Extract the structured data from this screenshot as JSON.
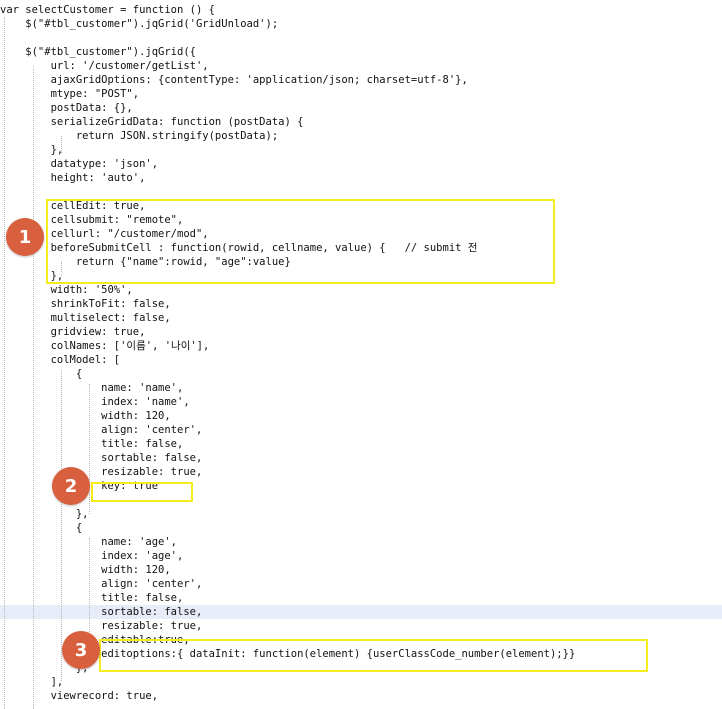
{
  "code_lines": [
    "var selectCustomer = function () {",
    "    $(\"#tbl_customer\").jqGrid('GridUnload');",
    "",
    "    $(\"#tbl_customer\").jqGrid({",
    "        url: '/customer/getList',",
    "        ajaxGridOptions: {contentType: 'application/json; charset=utf-8'},",
    "        mtype: \"POST\",",
    "        postData: {},",
    "        serializeGridData: function (postData) {",
    "            return JSON.stringify(postData);",
    "        },",
    "        datatype: 'json',",
    "        height: 'auto',",
    "",
    "        cellEdit: true,",
    "        cellsubmit: \"remote\",",
    "        cellurl: \"/customer/mod\",",
    "        beforeSubmitCell : function(rowid, cellname, value) {   // submit 전",
    "            return {\"name\":rowid, \"age\":value}",
    "        },",
    "        width: '50%',",
    "        shrinkToFit: false,",
    "        multiselect: false,",
    "        gridview: true,",
    "        colNames: ['이름', '나이'],",
    "        colModel: [",
    "            {",
    "                name: 'name',",
    "                index: 'name',",
    "                width: 120,",
    "                align: 'center',",
    "                title: false,",
    "                sortable: false,",
    "                resizable: true,",
    "                key: true",
    "",
    "            },",
    "            {",
    "                name: 'age',",
    "                index: 'age',",
    "                width: 120,",
    "                align: 'center',",
    "                title: false,",
    "                sortable: false,",
    "                resizable: true,",
    "                editable:true,",
    "                editoptions:{ dataInit: function(element) {userClassCode_number(element);}}",
    "            },",
    "        ],",
    "        viewrecord: true,"
  ],
  "current_line_index": 43,
  "annotations": [
    {
      "label": "1"
    },
    {
      "label": "2"
    },
    {
      "label": "3"
    }
  ],
  "colors": {
    "highlight_box": "#f5ec1e",
    "badge": "#d9603e",
    "current_line": "#e8ecf8"
  }
}
